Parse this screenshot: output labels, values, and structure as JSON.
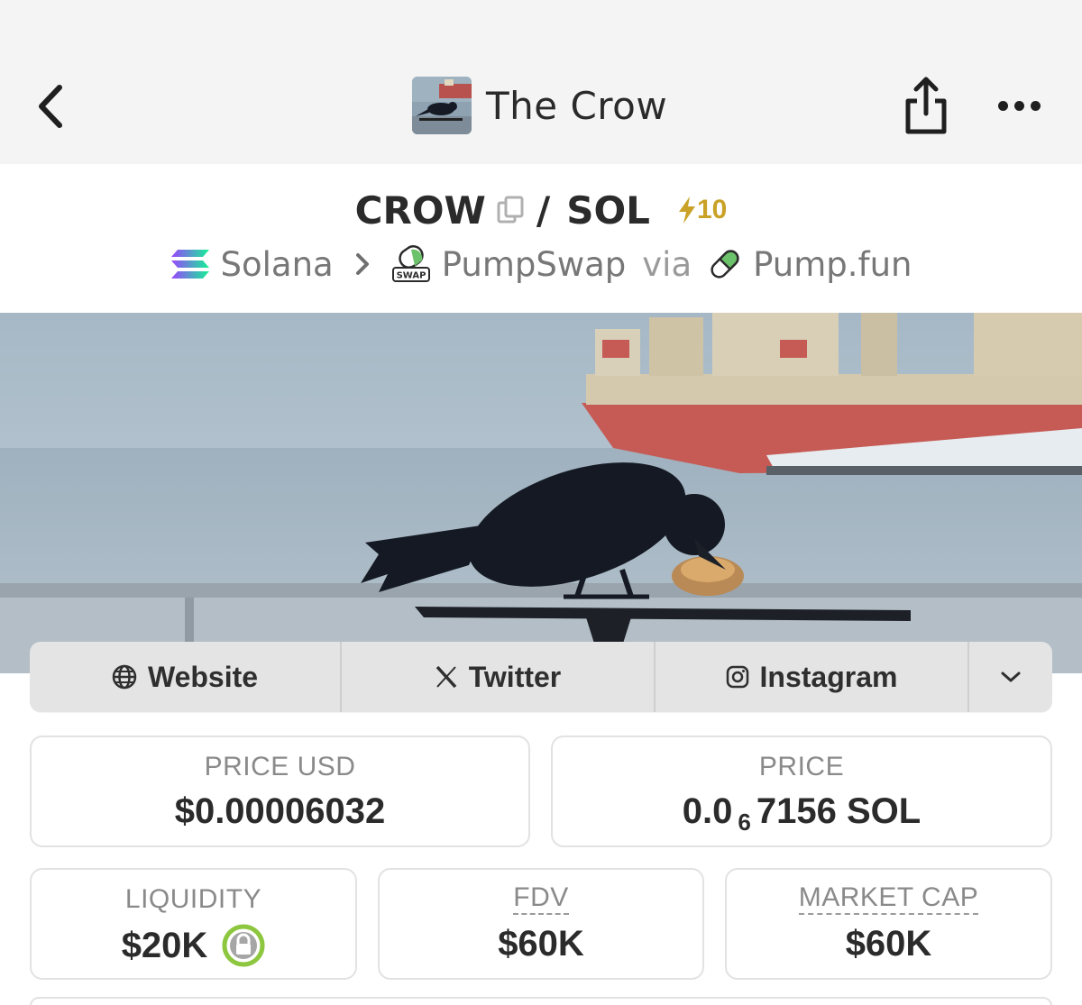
{
  "nav": {
    "title": "The Crow"
  },
  "pair": {
    "base": "CROW",
    "separator": "/",
    "quote": "SOL",
    "boost": "10"
  },
  "chain": {
    "network": "Solana",
    "dex": "PumpSwap",
    "dex_badge": "SWAP",
    "via": "via",
    "launchpad": "Pump.fun"
  },
  "links": {
    "website": "Website",
    "twitter": "Twitter",
    "instagram": "Instagram"
  },
  "stats": {
    "price_usd_label": "PRICE USD",
    "price_usd": "$0.00006032",
    "price_label": "PRICE",
    "price_prefix": "0.0",
    "price_zeros": "6",
    "price_suffix": "7156 SOL",
    "liquidity_label": "LIQUIDITY",
    "liquidity": "$20K",
    "fdv_label": "FDV",
    "fdv": "$60K",
    "mcap_label": "MARKET CAP",
    "mcap": "$60K"
  },
  "colors": {
    "boost": "#c9a227",
    "lock_ring": "#8dc63f",
    "solana_1": "#14f195",
    "solana_2": "#9945ff"
  }
}
